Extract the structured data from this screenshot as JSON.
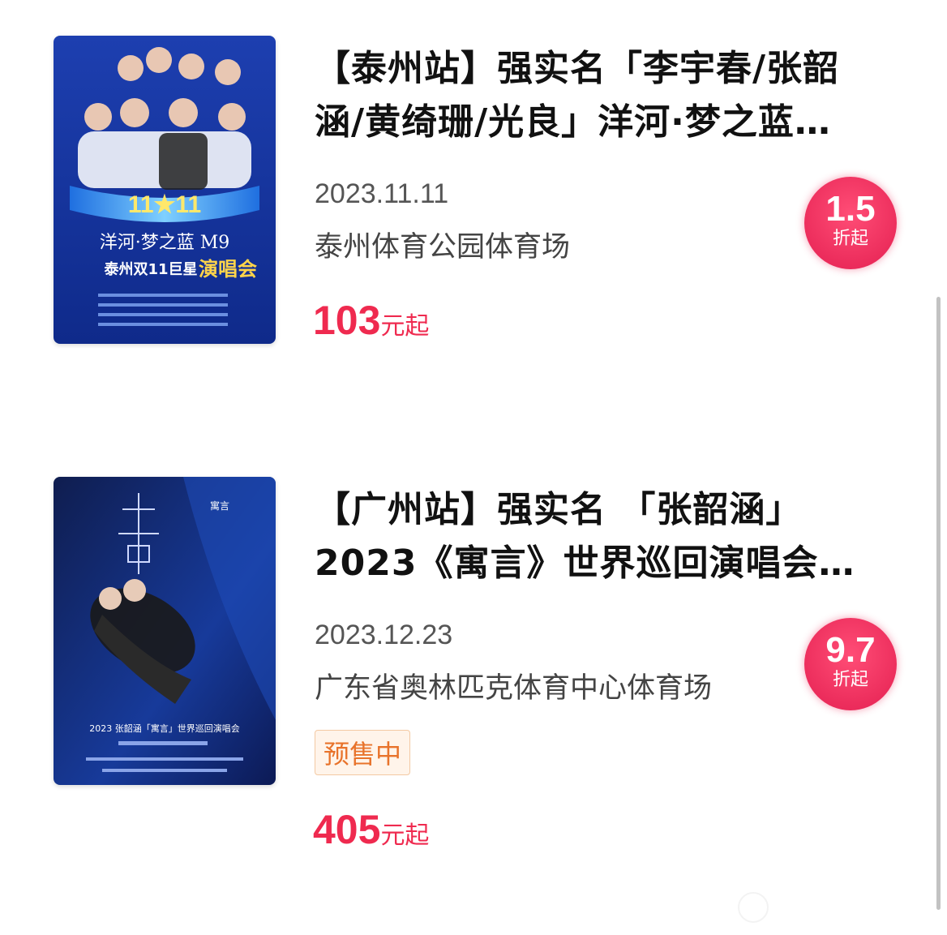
{
  "events": [
    {
      "title": "【泰州站】强实名「李宇春/张韶涵/黄绮珊/光良」洋河·梦之蓝…",
      "date": "2023.11.11",
      "venue": "泰州体育公园体育场",
      "price_value": "103",
      "price_suffix": "元起",
      "discount_rate": "1.5",
      "discount_unit": "折起",
      "poster_icon": "concert-poster-taizhou"
    },
    {
      "title": "【广州站】强实名 「张韶涵」 2023《寓言》世界巡回演唱会…",
      "date": "2023.12.23",
      "venue": "广东省奥林匹克体育中心体育场",
      "status_badge": "预售中",
      "price_value": "405",
      "price_suffix": "元起",
      "discount_rate": "9.7",
      "discount_unit": "折起",
      "poster_icon": "concert-poster-guangzhou"
    }
  ],
  "colors": {
    "price": "#ef2a4f",
    "discount_badge": "#ec2d5c",
    "presale_text": "#e8732b",
    "presale_bg": "#fff4ea"
  }
}
